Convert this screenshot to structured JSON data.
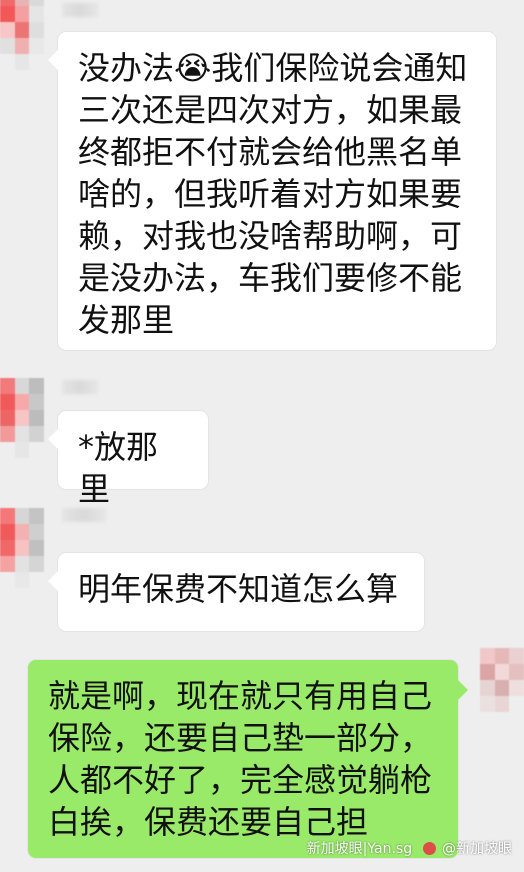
{
  "messages": [
    {
      "side": "left",
      "text": "没办法😭我们保险说会通知三次还是四次对方，如果最终都拒不付就会给他黑名单啥的，但我听着对方如果要赖，对我也没啥帮助啊，可是没办法，车我们要修不能发那里"
    },
    {
      "side": "left",
      "text": "*放那里"
    },
    {
      "side": "left",
      "text": "明年保费不知道怎么算"
    },
    {
      "side": "right",
      "text": "就是啊，现在就只有用自己保险，还要自己垫一部分，人都不好了，完全感觉躺枪白挨，保费还要自己担"
    }
  ],
  "watermark": {
    "site": "新加坡眼|Yan.sg",
    "weibo": "@新加坡眼"
  },
  "colors": {
    "background": "#eeeeee",
    "left_bubble": "#ffffff",
    "right_bubble": "#9aea6a"
  }
}
